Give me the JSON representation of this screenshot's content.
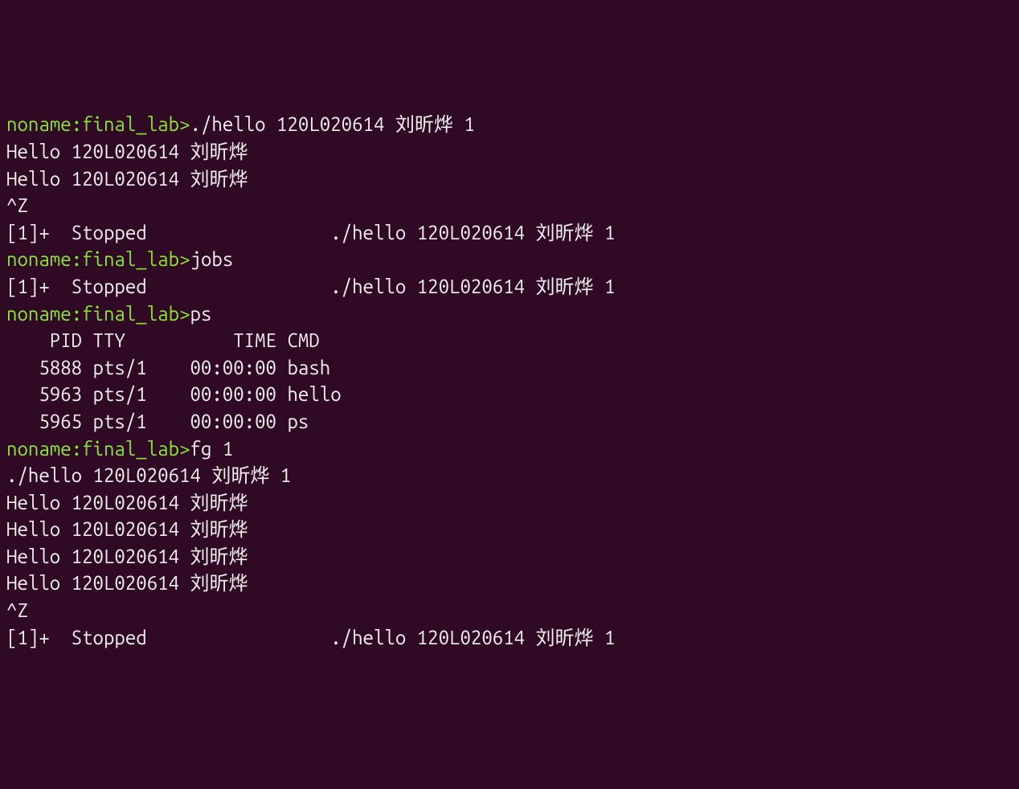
{
  "prompt": {
    "user": "noname",
    "path": "final_lab",
    "sep": ":",
    "end": ">"
  },
  "lines": [
    {
      "type": "cmd",
      "command": "./hello 120L020614 刘昕烨 1"
    },
    {
      "type": "out",
      "text": "Hello 120L020614 刘昕烨"
    },
    {
      "type": "out",
      "text": "Hello 120L020614 刘昕烨"
    },
    {
      "type": "out",
      "text": "^Z"
    },
    {
      "type": "out",
      "text": "[1]+  Stopped                 ./hello 120L020614 刘昕烨 1"
    },
    {
      "type": "cmd",
      "command": "jobs"
    },
    {
      "type": "out",
      "text": "[1]+  Stopped                 ./hello 120L020614 刘昕烨 1"
    },
    {
      "type": "cmd",
      "command": "ps"
    },
    {
      "type": "out",
      "text": "    PID TTY          TIME CMD"
    },
    {
      "type": "out",
      "text": "   5888 pts/1    00:00:00 bash"
    },
    {
      "type": "out",
      "text": "   5963 pts/1    00:00:00 hello"
    },
    {
      "type": "out",
      "text": "   5965 pts/1    00:00:00 ps"
    },
    {
      "type": "cmd",
      "command": "fg 1"
    },
    {
      "type": "out",
      "text": "./hello 120L020614 刘昕烨 1"
    },
    {
      "type": "out",
      "text": "Hello 120L020614 刘昕烨"
    },
    {
      "type": "out",
      "text": "Hello 120L020614 刘昕烨"
    },
    {
      "type": "out",
      "text": "Hello 120L020614 刘昕烨"
    },
    {
      "type": "out",
      "text": "Hello 120L020614 刘昕烨"
    },
    {
      "type": "out",
      "text": "^Z"
    },
    {
      "type": "out",
      "text": "[1]+  Stopped                 ./hello 120L020614 刘昕烨 1"
    }
  ]
}
